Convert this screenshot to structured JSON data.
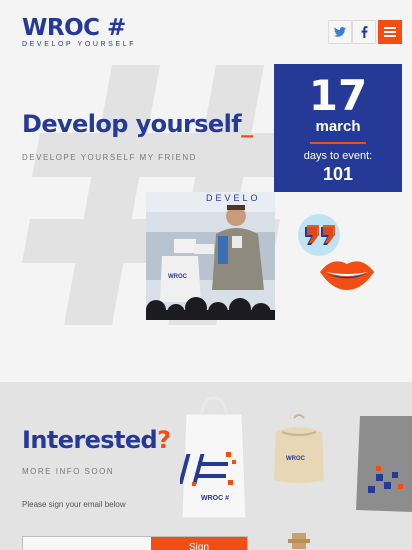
{
  "header": {
    "logo_text": "WROC",
    "logo_hash": "#",
    "logo_tagline": "DEVELOP YOURSELF",
    "twitter_icon": "twitter-icon",
    "facebook_icon": "facebook-icon",
    "menu_icon": "hamburger-menu-icon"
  },
  "hero": {
    "title": "Develop yourself",
    "title_cursor": "_",
    "subtitle": "DEVELOPE YOURSELF MY FRIEND",
    "photo_banner_text": "DEVELO"
  },
  "event": {
    "day": "17",
    "month": "march",
    "countdown_label": "days to event:",
    "days_left": "101"
  },
  "interested": {
    "title": "Interested",
    "title_mark": "?",
    "subtitle": "MORE INFO SOON",
    "note": "Please sign your email below",
    "email_placeholder": "",
    "send_label": "Sign"
  },
  "merch": {
    "bag_brand": "WROC #",
    "pouch_brand": "WROC"
  },
  "colors": {
    "brand_blue": "#253a97",
    "accent_orange": "#f04e13"
  }
}
